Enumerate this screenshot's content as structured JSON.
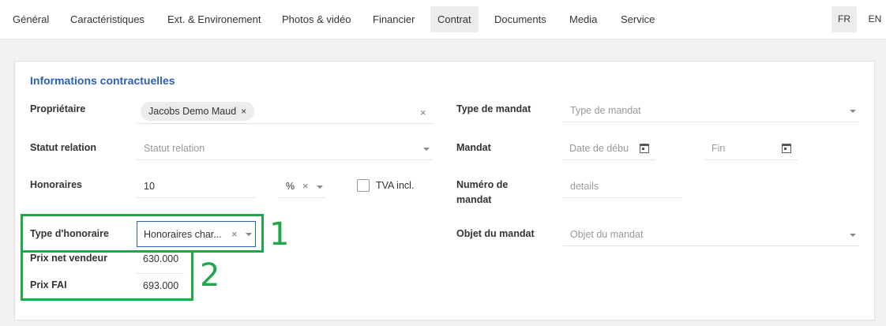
{
  "nav": {
    "tabs": [
      {
        "label": "Général"
      },
      {
        "label": "Caractéristiques"
      },
      {
        "label": "Ext. & Environement"
      },
      {
        "label": "Photos & vidéo"
      },
      {
        "label": "Financier"
      },
      {
        "label": "Contrat",
        "active": true
      },
      {
        "label": "Documents"
      },
      {
        "label": "Media"
      },
      {
        "label": "Service"
      }
    ],
    "languages": [
      {
        "label": "FR",
        "active": true
      },
      {
        "label": "EN"
      }
    ]
  },
  "section": {
    "title": "Informations contractuelles"
  },
  "form": {
    "proprietaire": {
      "label": "Propriétaire",
      "chip": "Jacobs Demo Maud",
      "chip_remove": "×",
      "clear": "×"
    },
    "statut": {
      "label": "Statut relation",
      "placeholder": "Statut relation"
    },
    "honoraires": {
      "label": "Honoraires",
      "value": "10",
      "unit": "%",
      "unit_clear": "×"
    },
    "tva": {
      "label": "TVA incl.",
      "checked": false
    },
    "type_honoraire": {
      "label": "Type d'honoraire",
      "value": "Honoraires char...",
      "clear": "×"
    },
    "prix_net": {
      "label": "Prix net vendeur",
      "value": "630.000"
    },
    "prix_fai": {
      "label": "Prix FAI",
      "value": "693.000"
    },
    "type_mandat": {
      "label": "Type de mandat",
      "placeholder": "Type de mandat"
    },
    "mandat": {
      "label": "Mandat",
      "start_placeholder": "Date de débu",
      "end_placeholder": "Fin"
    },
    "numero_mandat": {
      "label_line1": "Numéro de",
      "label_line2": "mandat",
      "placeholder": "details"
    },
    "objet_mandat": {
      "label": "Objet du mandat",
      "placeholder": "Objet du mandat"
    }
  },
  "annotations": [
    {
      "number": "1",
      "color": "#1fa84a"
    },
    {
      "number": "2",
      "color": "#1fa84a"
    }
  ],
  "colors": {
    "accent": "#2d5fb3",
    "annotation": "#1fa84a"
  }
}
